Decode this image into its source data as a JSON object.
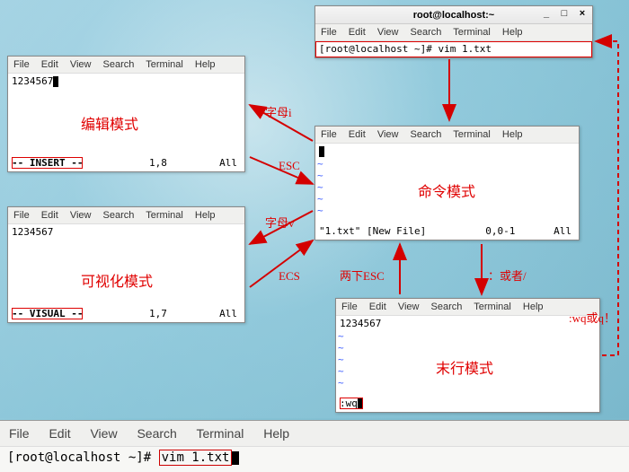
{
  "menus": {
    "file": "File",
    "edit": "Edit",
    "view": "View",
    "search": "Search",
    "terminal": "Terminal",
    "help": "Help"
  },
  "top_window": {
    "title": "root@localhost:~",
    "prompt_line": "[root@localhost ~]# vim 1.txt"
  },
  "insert_win": {
    "content": "1234567",
    "status_mode": "-- INSERT --",
    "status_pos": "1,8",
    "status_all": "All",
    "label": "编辑模式"
  },
  "visual_win": {
    "content": "1234567",
    "status_mode": "-- VISUAL --",
    "status_pos": "1,7",
    "status_all": "All",
    "label": "可视化模式"
  },
  "command_win": {
    "status_file": "\"1.txt\" [New File]",
    "status_pos": "0,0-1",
    "status_all": "All",
    "label": "命令模式"
  },
  "lastline_win": {
    "content": "1234567",
    "ex_prompt": ":wq",
    "label": "末行模式"
  },
  "arrows": {
    "letter_i": "字母i",
    "esc": "ESC",
    "letter_v": "字母v",
    "ecs": "ECS",
    "double_esc": "两下ESC",
    "colon_slash": "：或者/",
    "wq_q": ":wq或q！"
  },
  "bottom": {
    "prompt": "[root@localhost ~]#",
    "command": "vim 1.txt"
  },
  "window_controls": {
    "min": "_",
    "max": "□",
    "close": "×"
  }
}
